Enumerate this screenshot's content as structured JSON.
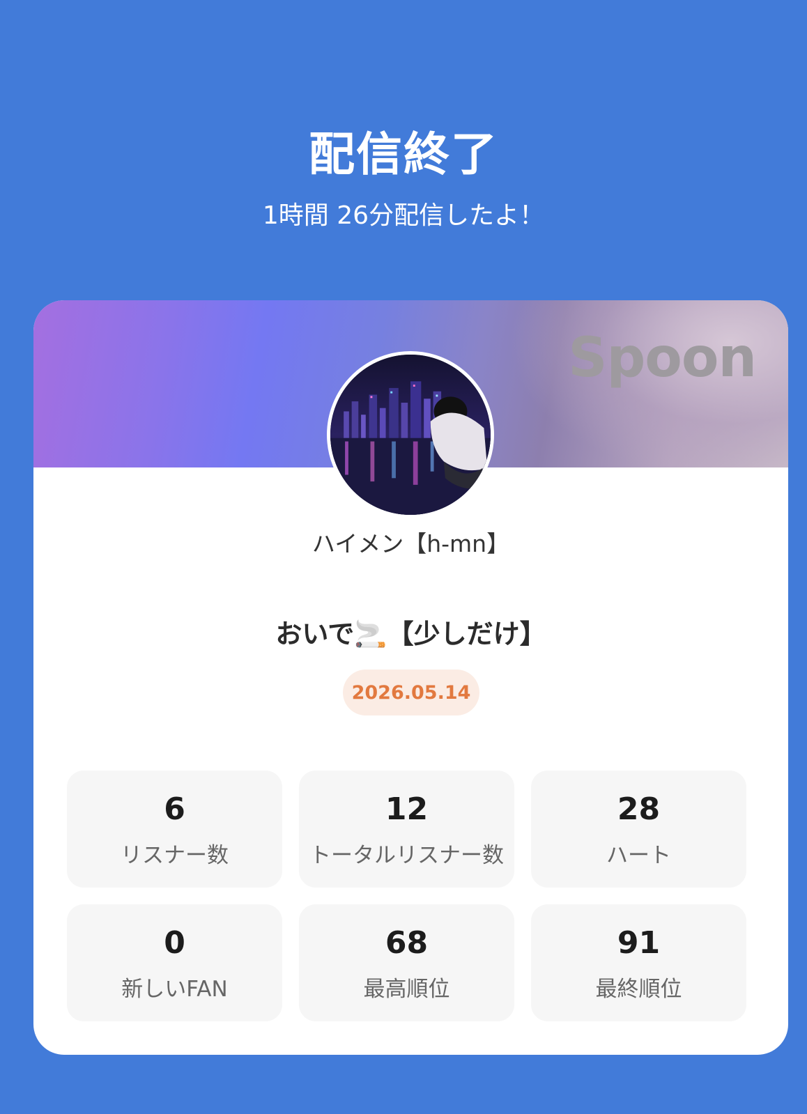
{
  "header": {
    "title": "配信終了",
    "subtitle": "1時間 26分配信したよ！"
  },
  "card": {
    "brand": "Spoon",
    "username": "ハイメン【h-mn】",
    "live_title": "おいで🚬【少しだけ】",
    "date": "2026.05.14",
    "stats": [
      {
        "value": "6",
        "label": "リスナー数"
      },
      {
        "value": "12",
        "label": "トータルリスナー数"
      },
      {
        "value": "28",
        "label": "ハート"
      },
      {
        "value": "0",
        "label": "新しいFAN"
      },
      {
        "value": "68",
        "label": "最高順位"
      },
      {
        "value": "91",
        "label": "最終順位"
      }
    ]
  },
  "colors": {
    "background": "#427bd9",
    "date_text": "#e2793f",
    "date_badge": "#fbece4"
  }
}
